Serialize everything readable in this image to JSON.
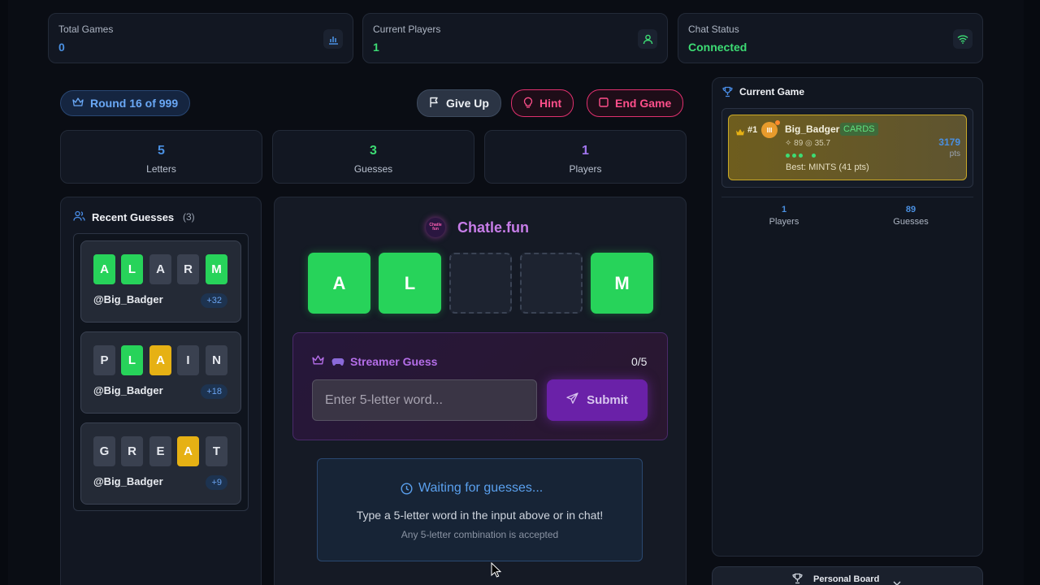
{
  "stats": [
    {
      "label": "Total Games",
      "value": "0",
      "value_color": "#4a90e2",
      "icon": "bar-chart-icon"
    },
    {
      "label": "Current Players",
      "value": "1",
      "value_color": "#3ddc74",
      "icon": "user-icon"
    },
    {
      "label": "Chat Status",
      "value": "Connected",
      "value_color": "#3ddc74",
      "icon": "wifi-icon"
    }
  ],
  "round": {
    "label": "Round 16 of 999",
    "icon": "crown-icon"
  },
  "actions": {
    "give_up": "Give Up",
    "hint": "Hint",
    "end_game": "End Game"
  },
  "summary": [
    {
      "value": "5",
      "label": "Letters",
      "color": "#4a90e2"
    },
    {
      "value": "3",
      "label": "Guesses",
      "color": "#3ddc74"
    },
    {
      "value": "1",
      "label": "Players",
      "color": "#a276f0"
    }
  ],
  "recent": {
    "title": "Recent Guesses",
    "count": "(3)",
    "guesses": [
      {
        "letters": [
          "A",
          "L",
          "A",
          "R",
          "M"
        ],
        "states": [
          "g",
          "g",
          "x",
          "x",
          "g"
        ],
        "user": "@Big_Badger",
        "points": "+32"
      },
      {
        "letters": [
          "P",
          "L",
          "A",
          "I",
          "N"
        ],
        "states": [
          "x",
          "g",
          "y",
          "x",
          "x"
        ],
        "user": "@Big_Badger",
        "points": "+18"
      },
      {
        "letters": [
          "G",
          "R",
          "E",
          "A",
          "T"
        ],
        "states": [
          "x",
          "x",
          "x",
          "y",
          "x"
        ],
        "user": "@Big_Badger",
        "points": "+9"
      }
    ]
  },
  "board": {
    "brand": "Chatle.fun",
    "logo_text": "Chatle\nfun",
    "tiles": [
      "A",
      "L",
      "",
      "",
      "M"
    ],
    "streamer_title": "Streamer Guess",
    "streamer_count": "0/5",
    "input_placeholder": "Enter 5-letter word...",
    "submit": "Submit",
    "waiting_title": "Waiting for guesses...",
    "waiting_line1": "Type a 5-letter word in the input above or in chat!",
    "waiting_line2": "Any 5-letter combination is accepted"
  },
  "current_game": {
    "title": "Current Game",
    "rank": "#1",
    "player": "Big_Badger",
    "badge": "CARDS",
    "sub": "✧ 89 ◎ 35.7",
    "best": "Best: MINTS (41 pts)",
    "points": "3179",
    "points_unit": "pts",
    "players_value": "1",
    "players_label": "Players",
    "guesses_value": "89",
    "guesses_label": "Guesses"
  },
  "personal_board": {
    "label": "Personal Board"
  }
}
